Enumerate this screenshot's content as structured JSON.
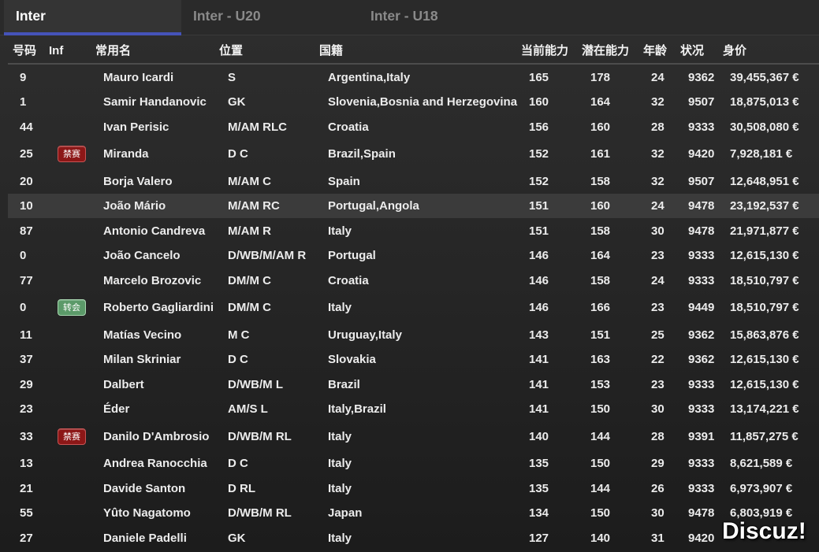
{
  "tabs": [
    {
      "label": "Inter",
      "active": true
    },
    {
      "label": "Inter - U20",
      "active": false
    },
    {
      "label": "Inter - U18",
      "active": false
    }
  ],
  "columns": {
    "number": "号码",
    "inf": "Inf",
    "name": "常用名",
    "position": "位置",
    "nationality": "国籍",
    "current_ability": "当前能力",
    "potential_ability": "潜在能力",
    "age": "年龄",
    "condition": "状况",
    "value": "身价"
  },
  "colors": {
    "accent": "#4553b9",
    "selected_row": "#3b3b3b"
  },
  "players": [
    {
      "number": 9,
      "name": "Mauro Icardi",
      "position": "S",
      "nationality": "Argentina,Italy",
      "current_ability": 165,
      "potential_ability": 178,
      "age": 24,
      "condition": 9362,
      "value": "39,455,367 €"
    },
    {
      "number": 1,
      "name": "Samir Handanovic",
      "position": "GK",
      "nationality": "Slovenia,Bosnia and Herzegovina",
      "current_ability": 160,
      "potential_ability": 164,
      "age": 32,
      "condition": 9507,
      "value": "18,875,013 €"
    },
    {
      "number": 44,
      "name": "Ivan Perisic",
      "position": "M/AM RLC",
      "nationality": "Croatia",
      "current_ability": 156,
      "potential_ability": 160,
      "age": 28,
      "condition": 9333,
      "value": "30,508,080 €"
    },
    {
      "number": 25,
      "inf": {
        "label": "禁赛",
        "bg": "#8c1717",
        "border": "#c65454"
      },
      "name": "Miranda",
      "position": "D C",
      "nationality": "Brazil,Spain",
      "current_ability": 152,
      "potential_ability": 161,
      "age": 32,
      "condition": 9420,
      "value": "7,928,181 €"
    },
    {
      "number": 20,
      "name": "Borja Valero",
      "position": "M/AM C",
      "nationality": "Spain",
      "current_ability": 152,
      "potential_ability": 158,
      "age": 32,
      "condition": 9507,
      "value": "12,648,951 €"
    },
    {
      "number": 10,
      "name": "João Mário",
      "position": "M/AM RC",
      "nationality": "Portugal,Angola",
      "current_ability": 151,
      "potential_ability": 160,
      "age": 24,
      "condition": 9478,
      "value": "23,192,537 €",
      "selected": true
    },
    {
      "number": 87,
      "name": "Antonio Candreva",
      "position": "M/AM R",
      "nationality": "Italy",
      "current_ability": 151,
      "potential_ability": 158,
      "age": 30,
      "condition": 9478,
      "value": "21,971,877 €"
    },
    {
      "number": 0,
      "name": "João Cancelo",
      "position": "D/WB/M/AM R",
      "nationality": "Portugal",
      "current_ability": 146,
      "potential_ability": 164,
      "age": 23,
      "condition": 9333,
      "value": "12,615,130 €"
    },
    {
      "number": 77,
      "name": "Marcelo Brozovic",
      "position": "DM/M C",
      "nationality": "Croatia",
      "current_ability": 146,
      "potential_ability": 158,
      "age": 24,
      "condition": 9333,
      "value": "18,510,797 €"
    },
    {
      "number": 0,
      "inf": {
        "label": "转会",
        "bg": "#5b9a69",
        "border": "#a6d4ae"
      },
      "name": "Roberto Gagliardini",
      "position": "DM/M C",
      "nationality": "Italy",
      "current_ability": 146,
      "potential_ability": 166,
      "age": 23,
      "condition": 9449,
      "value": "18,510,797 €"
    },
    {
      "number": 11,
      "name": "Matías Vecino",
      "position": "M C",
      "nationality": "Uruguay,Italy",
      "current_ability": 143,
      "potential_ability": 151,
      "age": 25,
      "condition": 9362,
      "value": "15,863,876 €"
    },
    {
      "number": 37,
      "name": "Milan Skriniar",
      "position": "D C",
      "nationality": "Slovakia",
      "current_ability": 141,
      "potential_ability": 163,
      "age": 22,
      "condition": 9362,
      "value": "12,615,130 €"
    },
    {
      "number": 29,
      "name": "Dalbert",
      "position": "D/WB/M L",
      "nationality": "Brazil",
      "current_ability": 141,
      "potential_ability": 153,
      "age": 23,
      "condition": 9333,
      "value": "12,615,130 €"
    },
    {
      "number": 23,
      "name": "Éder",
      "position": "AM/S L",
      "nationality": "Italy,Brazil",
      "current_ability": 141,
      "potential_ability": 150,
      "age": 30,
      "condition": 9333,
      "value": "13,174,221 €"
    },
    {
      "number": 33,
      "inf": {
        "label": "禁赛",
        "bg": "#8c1717",
        "border": "#c65454"
      },
      "name": "Danilo D'Ambrosio",
      "position": "D/WB/M RL",
      "nationality": "Italy",
      "current_ability": 140,
      "potential_ability": 144,
      "age": 28,
      "condition": 9391,
      "value": "11,857,275 €"
    },
    {
      "number": 13,
      "name": "Andrea Ranocchia",
      "position": "D C",
      "nationality": "Italy",
      "current_ability": 135,
      "potential_ability": 150,
      "age": 29,
      "condition": 9333,
      "value": "8,621,589 €"
    },
    {
      "number": 21,
      "name": "Davide Santon",
      "position": "D RL",
      "nationality": "Italy",
      "current_ability": 135,
      "potential_ability": 144,
      "age": 26,
      "condition": 9333,
      "value": "6,973,907 €"
    },
    {
      "number": 55,
      "name": "Yûto Nagatomo",
      "position": "D/WB/M RL",
      "nationality": "Japan",
      "current_ability": 134,
      "potential_ability": 150,
      "age": 30,
      "condition": 9478,
      "value": "6,803,919 €"
    },
    {
      "number": 27,
      "name": "Daniele Padelli",
      "position": "GK",
      "nationality": "Italy",
      "current_ability": 127,
      "potential_ability": 140,
      "age": 31,
      "condition": 9420
    }
  ],
  "watermark": "Discuz!"
}
